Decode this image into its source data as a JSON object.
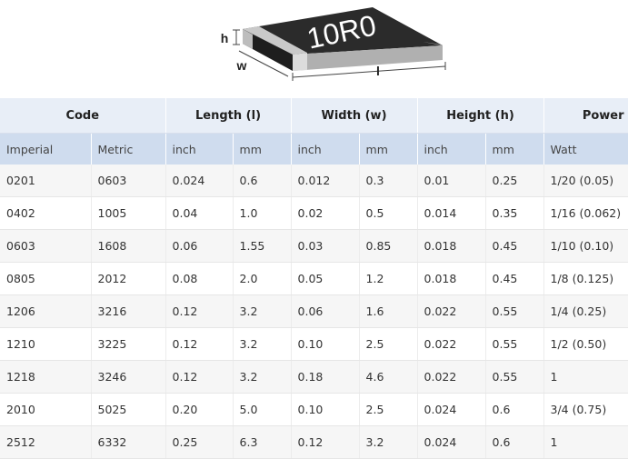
{
  "figure": {
    "marking": "10R0",
    "dim_h": "h",
    "dim_w": "w",
    "dim_l": "l"
  },
  "table": {
    "group_headers": [
      "Code",
      "Length (l)",
      "Width (w)",
      "Height (h)",
      "Power"
    ],
    "sub_headers": [
      "Imperial",
      "Metric",
      "inch",
      "mm",
      "inch",
      "mm",
      "inch",
      "mm",
      "Watt"
    ],
    "rows": [
      [
        "0201",
        "0603",
        "0.024",
        "0.6",
        "0.012",
        "0.3",
        "0.01",
        "0.25",
        "1/20 (0.05)"
      ],
      [
        "0402",
        "1005",
        "0.04",
        "1.0",
        "0.02",
        "0.5",
        "0.014",
        "0.35",
        "1/16 (0.062)"
      ],
      [
        "0603",
        "1608",
        "0.06",
        "1.55",
        "0.03",
        "0.85",
        "0.018",
        "0.45",
        "1/10 (0.10)"
      ],
      [
        "0805",
        "2012",
        "0.08",
        "2.0",
        "0.05",
        "1.2",
        "0.018",
        "0.45",
        "1/8 (0.125)"
      ],
      [
        "1206",
        "3216",
        "0.12",
        "3.2",
        "0.06",
        "1.6",
        "0.022",
        "0.55",
        "1/4 (0.25)"
      ],
      [
        "1210",
        "3225",
        "0.12",
        "3.2",
        "0.10",
        "2.5",
        "0.022",
        "0.55",
        "1/2 (0.50)"
      ],
      [
        "1218",
        "3246",
        "0.12",
        "3.2",
        "0.18",
        "4.6",
        "0.022",
        "0.55",
        "1"
      ],
      [
        "2010",
        "5025",
        "0.20",
        "5.0",
        "0.10",
        "2.5",
        "0.024",
        "0.6",
        "3/4 (0.75)"
      ],
      [
        "2512",
        "6332",
        "0.25",
        "6.3",
        "0.12",
        "3.2",
        "0.024",
        "0.6",
        "1"
      ]
    ]
  }
}
